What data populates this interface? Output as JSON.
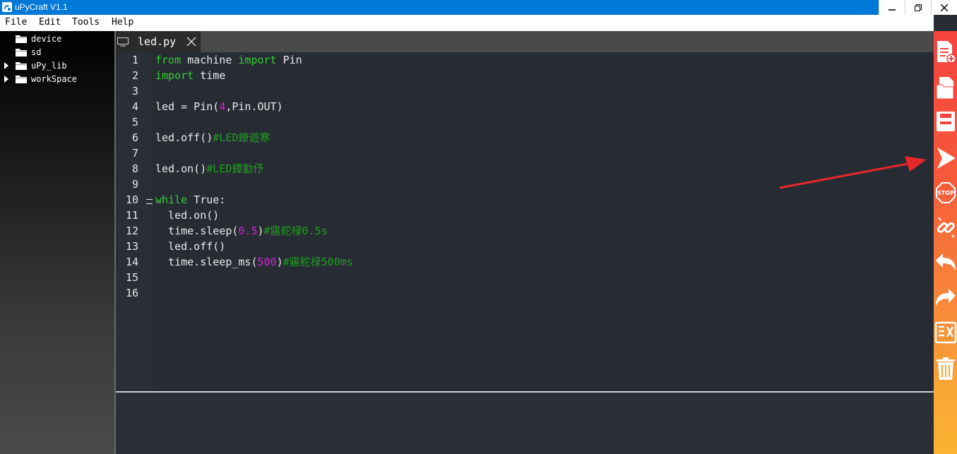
{
  "window": {
    "title": "uPyCraft V1.1",
    "controls": [
      "minimize-icon",
      "restore-icon",
      "close-icon"
    ]
  },
  "menu": {
    "items": [
      "File",
      "Edit",
      "Tools",
      "Help"
    ]
  },
  "file_tree": {
    "items": [
      {
        "label": "device",
        "expandable": false
      },
      {
        "label": "sd",
        "expandable": false
      },
      {
        "label": "uPy_lib",
        "expandable": true
      },
      {
        "label": "workSpace",
        "expandable": true
      }
    ]
  },
  "editor": {
    "tab": {
      "label": "led.py"
    },
    "line_numbers": [
      "1",
      "2",
      "3",
      "4",
      "5",
      "6",
      "7",
      "8",
      "9",
      "10",
      "11",
      "12",
      "13",
      "14",
      "15",
      "16"
    ],
    "lines": [
      [
        {
          "t": "from",
          "c": "kw"
        },
        {
          "t": " machine ",
          "c": ""
        },
        {
          "t": "import",
          "c": "kw"
        },
        {
          "t": " Pin",
          "c": ""
        }
      ],
      [
        {
          "t": "import",
          "c": "kw"
        },
        {
          "t": " time",
          "c": ""
        }
      ],
      [],
      [
        {
          "t": "led = Pin(",
          "c": ""
        },
        {
          "t": "4",
          "c": "num"
        },
        {
          "t": ",Pin.OUT)",
          "c": ""
        }
      ],
      [],
      [
        {
          "t": "led.off()",
          "c": ""
        },
        {
          "t": "#LED鐐遊寒",
          "c": "cm"
        }
      ],
      [],
      [
        {
          "t": "led.on()",
          "c": ""
        },
        {
          "t": "#LED鐔勭伃",
          "c": "cm"
        }
      ],
      [],
      [
        {
          "t": "while",
          "c": "kw"
        },
        {
          "t": " True:",
          "c": ""
        }
      ],
      [
        {
          "t": "  led.on()",
          "c": ""
        }
      ],
      [
        {
          "t": "  time.sleep(",
          "c": ""
        },
        {
          "t": "0.5",
          "c": "num"
        },
        {
          "t": ")",
          "c": ""
        },
        {
          "t": "#寤舵椂0.5s",
          "c": "cm"
        }
      ],
      [
        {
          "t": "  led.off()",
          "c": ""
        }
      ],
      [
        {
          "t": "  time.sleep_ms(",
          "c": ""
        },
        {
          "t": "500",
          "c": "num"
        },
        {
          "t": ")",
          "c": ""
        },
        {
          "t": "#寤舵椂500ms",
          "c": "cm"
        }
      ],
      [],
      []
    ]
  },
  "toolbar": {
    "buttons": [
      "new-file-icon",
      "open-file-icon",
      "save-icon",
      "run-icon",
      "stop-icon",
      "connect-icon",
      "undo-icon",
      "redo-icon",
      "syntax-check-icon",
      "clear-icon"
    ],
    "stop_label": "STOP"
  },
  "colors": {
    "titlebar": "#0078d7",
    "editor_bg": "#272b33",
    "keyword": "#32d232",
    "number": "#d224d2",
    "comment": "#1f9e1f",
    "toolbar_top": "#f6433f",
    "toolbar_bottom": "#fbb231",
    "annotation": "#e8272c"
  }
}
